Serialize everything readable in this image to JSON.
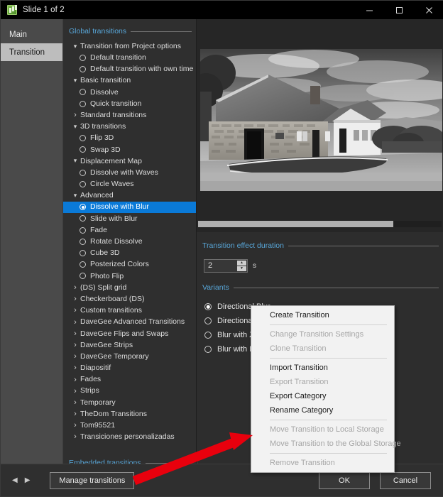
{
  "window": {
    "title": "Slide 1 of 2",
    "app_icon": "slideshow-icon",
    "minimize_label": "–",
    "maximize_label": "□",
    "close_label": "✕"
  },
  "rail": {
    "tabs": [
      {
        "label": "Main",
        "selected": false
      },
      {
        "label": "Transition",
        "selected": true
      }
    ]
  },
  "tree_panel": {
    "group_header": "Global transitions",
    "footer_header": "Embedded transitions",
    "items": [
      {
        "label": "Transition from Project options",
        "kind": "group",
        "chevron": "down",
        "indent": 1
      },
      {
        "label": "Default transition",
        "kind": "radio",
        "selected": false,
        "indent": 2
      },
      {
        "label": "Default transition with own time",
        "kind": "radio",
        "selected": false,
        "indent": 2
      },
      {
        "label": "Basic transition",
        "kind": "group",
        "chevron": "down",
        "indent": 1
      },
      {
        "label": "Dissolve",
        "kind": "radio",
        "selected": false,
        "indent": 2
      },
      {
        "label": "Quick transition",
        "kind": "radio",
        "selected": false,
        "indent": 2
      },
      {
        "label": "Standard transitions",
        "kind": "group",
        "chevron": "right",
        "indent": 1
      },
      {
        "label": "3D transitions",
        "kind": "group",
        "chevron": "down",
        "indent": 1
      },
      {
        "label": "Flip 3D",
        "kind": "radio",
        "selected": false,
        "indent": 2
      },
      {
        "label": "Swap 3D",
        "kind": "radio",
        "selected": false,
        "indent": 2
      },
      {
        "label": "Displacement Map",
        "kind": "group",
        "chevron": "down",
        "indent": 1
      },
      {
        "label": "Dissolve with Waves",
        "kind": "radio",
        "selected": false,
        "indent": 2
      },
      {
        "label": "Circle Waves",
        "kind": "radio",
        "selected": false,
        "indent": 2
      },
      {
        "label": "Advanced",
        "kind": "group",
        "chevron": "down",
        "indent": 1
      },
      {
        "label": "Dissolve with Blur",
        "kind": "radio",
        "selected": true,
        "indent": 2,
        "highlighted": true
      },
      {
        "label": "Slide with Blur",
        "kind": "radio",
        "selected": false,
        "indent": 2
      },
      {
        "label": "Fade",
        "kind": "radio",
        "selected": false,
        "indent": 2
      },
      {
        "label": "Rotate Dissolve",
        "kind": "radio",
        "selected": false,
        "indent": 2
      },
      {
        "label": "Cube 3D",
        "kind": "radio",
        "selected": false,
        "indent": 2
      },
      {
        "label": "Posterized Colors",
        "kind": "radio",
        "selected": false,
        "indent": 2
      },
      {
        "label": "Photo Flip",
        "kind": "radio",
        "selected": false,
        "indent": 2
      },
      {
        "label": "(DS) Split grid",
        "kind": "group",
        "chevron": "right",
        "indent": 1
      },
      {
        "label": "Checkerboard (DS)",
        "kind": "group",
        "chevron": "right",
        "indent": 1
      },
      {
        "label": "Custom transitions",
        "kind": "group",
        "chevron": "right",
        "indent": 1
      },
      {
        "label": "DaveGee Advanced Transitions",
        "kind": "group",
        "chevron": "right",
        "indent": 1
      },
      {
        "label": "DaveGee Flips and Swaps",
        "kind": "group",
        "chevron": "right",
        "indent": 1
      },
      {
        "label": "DaveGee Strips",
        "kind": "group",
        "chevron": "right",
        "indent": 1
      },
      {
        "label": "DaveGee Temporary",
        "kind": "group",
        "chevron": "right",
        "indent": 1
      },
      {
        "label": "Diapositif",
        "kind": "group",
        "chevron": "right",
        "indent": 1
      },
      {
        "label": "Fades",
        "kind": "group",
        "chevron": "right",
        "indent": 1
      },
      {
        "label": "Strips",
        "kind": "group",
        "chevron": "right",
        "indent": 1
      },
      {
        "label": "Temporary",
        "kind": "group",
        "chevron": "right",
        "indent": 1
      },
      {
        "label": "TheDom Transitions",
        "kind": "group",
        "chevron": "right",
        "indent": 1
      },
      {
        "label": "Tom95521",
        "kind": "group",
        "chevron": "right",
        "indent": 1
      },
      {
        "label": "Transiciones personalizadas",
        "kind": "group",
        "chevron": "right",
        "indent": 1
      }
    ]
  },
  "preview": {
    "image_description": "black-and-white photo of a stone cottage and farmhouse with gravel driveway under cloudy sky",
    "scroll_thumb_percent": 80
  },
  "duration": {
    "section_label": "Transition effect duration",
    "value": "2",
    "unit": "s",
    "spin_up": "▲",
    "spin_down": "▼"
  },
  "variants": {
    "section_label": "Variants",
    "items": [
      {
        "label": "Directional Blur",
        "selected": true
      },
      {
        "label": "Directional Blur 2",
        "selected": false
      },
      {
        "label": "Blur with Zoom",
        "selected": false
      },
      {
        "label": "Blur with Rotate",
        "selected": false
      }
    ]
  },
  "context_menu": {
    "items": [
      {
        "label": "Create Transition",
        "enabled": true
      },
      {
        "separator": true
      },
      {
        "label": "Change Transition Settings",
        "enabled": false
      },
      {
        "label": "Clone Transition",
        "enabled": false
      },
      {
        "separator": true
      },
      {
        "label": "Import Transition",
        "enabled": true
      },
      {
        "label": "Export Transition",
        "enabled": false
      },
      {
        "label": "Export Category",
        "enabled": true
      },
      {
        "label": "Rename Category",
        "enabled": true
      },
      {
        "separator": true
      },
      {
        "label": "Move Transition to Local Storage",
        "enabled": false
      },
      {
        "label": "Move Transition to the Global Storage",
        "enabled": false
      },
      {
        "separator": true
      },
      {
        "label": "Remove Transition",
        "enabled": false
      }
    ]
  },
  "bottom_bar": {
    "prev_label": "◀",
    "next_label": "▶",
    "manage_label": "Manage transitions",
    "ok_label": "OK",
    "cancel_label": "Cancel"
  },
  "annotation": {
    "arrow_color": "#e8000d",
    "description": "red arrow pointing from Manage transitions button to the context menu"
  },
  "colors": {
    "accent_blue": "#0a7ad8",
    "section_label": "#58a6d8",
    "window_bg": "#2d2d2d",
    "titlebar_bg": "#000000",
    "rail_bg": "#4a4a4a",
    "menu_bg": "#f2f2f2"
  }
}
